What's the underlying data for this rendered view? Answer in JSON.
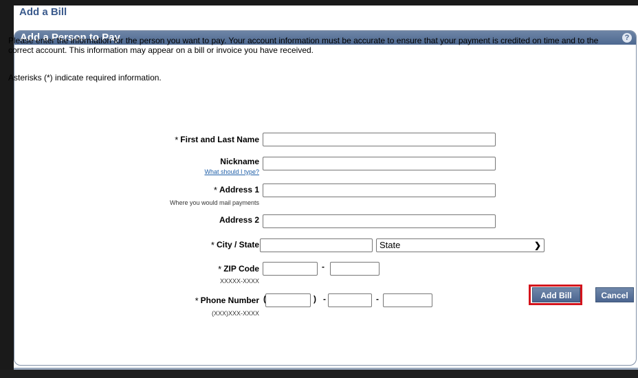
{
  "page_title": "Add a Bill",
  "panel": {
    "title": "Add a Person to Pay",
    "help_icon": "?"
  },
  "intro_text": "Please enter the information for the person you want to pay. Your account information must be accurate to ensure that your payment is credited on time and to the correct account. This information may appear on a bill or invoice you have received.",
  "asterisk_note": "Asterisks (*) indicate required information.",
  "form": {
    "name": {
      "label": "First and Last Name",
      "required": "*",
      "value": ""
    },
    "nickname": {
      "label": "Nickname",
      "help_link": "What should I type?",
      "value": ""
    },
    "address1": {
      "label": "Address 1",
      "required": "*",
      "hint": "Where you would mail payments",
      "value": ""
    },
    "address2": {
      "label": "Address 2",
      "value": ""
    },
    "city_state": {
      "label": "City / State",
      "required": "*",
      "city_value": "",
      "state_selected": "State"
    },
    "zip": {
      "label": "ZIP Code",
      "required": "*",
      "hint": "XXXXX-XXXX",
      "separator": "-"
    },
    "phone": {
      "label": "Phone Number",
      "required": "*",
      "hint": "(XXX)XXX-XXXX",
      "open_paren": "(",
      "close_paren": ")",
      "separator1": "-",
      "separator2": "-"
    }
  },
  "buttons": {
    "add_bill": "Add Bill",
    "cancel": "Cancel"
  }
}
